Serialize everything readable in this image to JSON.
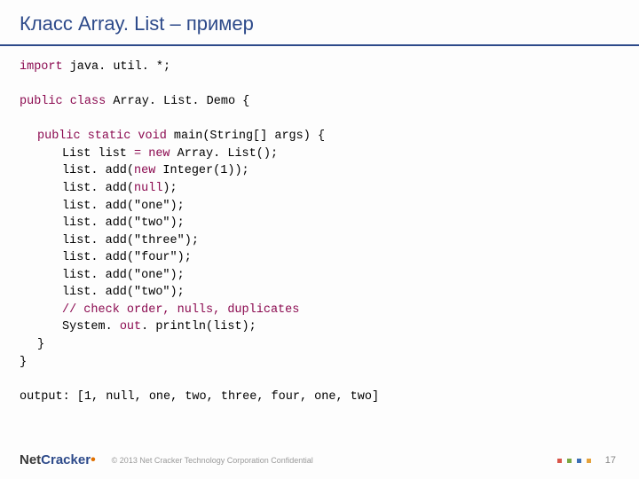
{
  "header": {
    "title": "Класс Array. List – пример"
  },
  "code": {
    "l1_kw": "import",
    "l1_rest": " java. util. *;",
    "l2_kw1": "public",
    "l2_kw2": " class",
    "l2_rest": " Array. List. Demo {",
    "l3_kw": "public static void",
    "l3_rest": " main(String[] args) {",
    "l4_a": "List list ",
    "l4_eq": "=",
    "l4_new": " new",
    "l4_b": " Array. List();",
    "l5_a": "list. add(",
    "l5_new": "new",
    "l5_b": " Integer(1));",
    "l6_a": "list. add(",
    "l6_null": "null",
    "l6_b": ");",
    "l7": "list. add(\"one\");",
    "l8": "list. add(\"two\");",
    "l9": "list. add(\"three\");",
    "l10": "list. add(\"four\");",
    "l11": "list. add(\"one\");",
    "l12": "list. add(\"two\");",
    "l13": "// check order, nulls, duplicates",
    "l14_a": "System. ",
    "l14_out": "out",
    "l14_b": ". println(list);",
    "l15": "}",
    "l16": "}",
    "output": "output: [1, null, one, two, three, four, one, two]"
  },
  "footer": {
    "logo_net": "Net",
    "logo_cracker": "Cracker",
    "logo_dot": "•",
    "copyright": "© 2013 Net Cracker Technology Corporation Confidential",
    "page": "17"
  }
}
